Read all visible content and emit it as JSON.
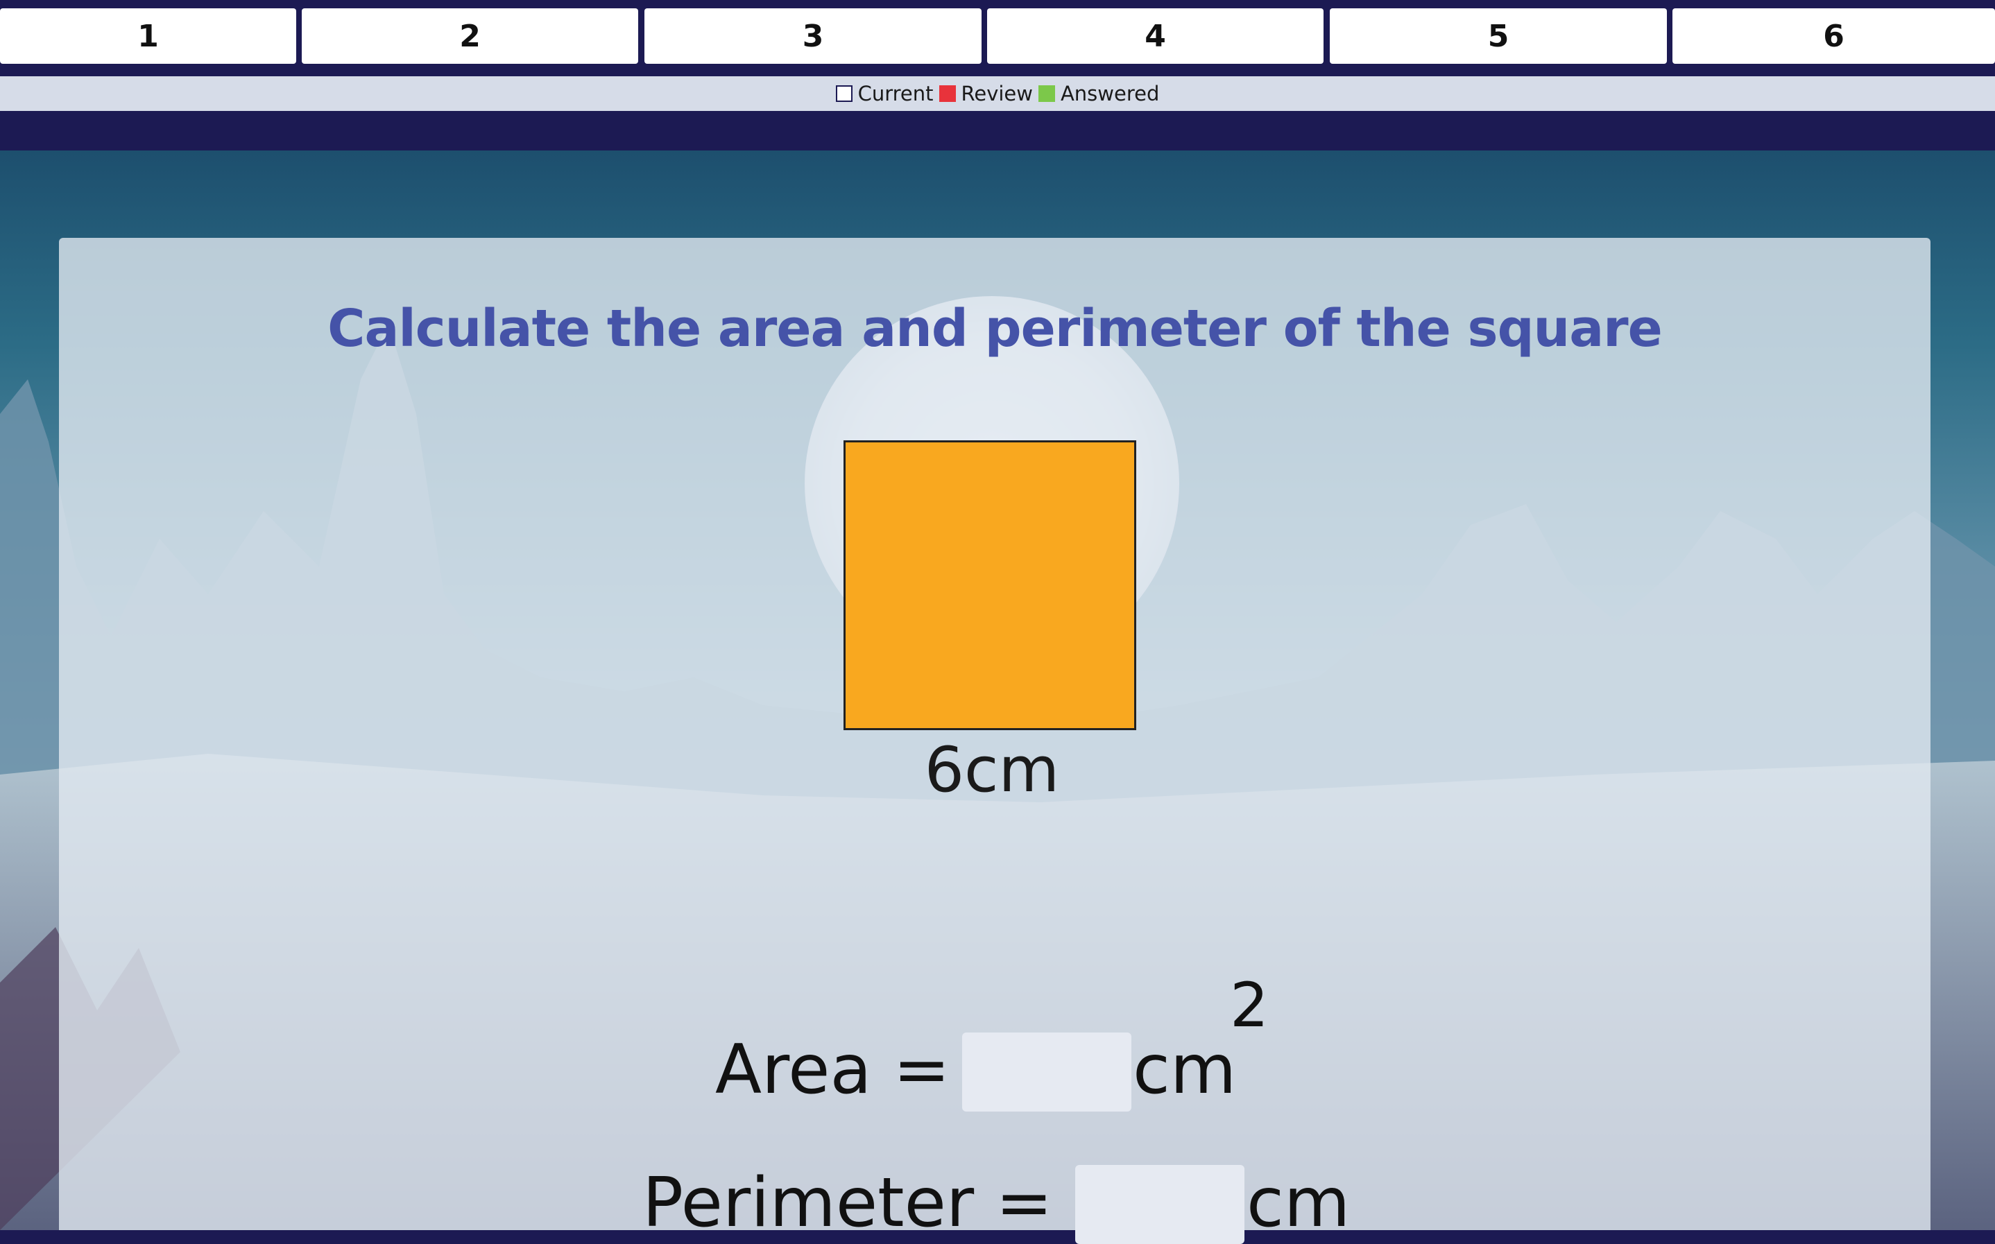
{
  "nav": {
    "questions": [
      "1",
      "2",
      "3",
      "4",
      "5",
      "6"
    ]
  },
  "legend": {
    "current": "Current",
    "review": "Review",
    "answered": "Answered"
  },
  "question": {
    "title": "Calculate the area and perimeter of the square",
    "side_label": "6cm",
    "area_label": "Area =",
    "area_unit": "cm",
    "area_superscript": "2",
    "perimeter_label": "Perimeter =",
    "perimeter_unit": "cm",
    "area_value": "",
    "perimeter_value": ""
  },
  "colors": {
    "nav_bg": "#1c1a53",
    "square_fill": "#f9a81f",
    "title": "#4553a8",
    "review": "#e8333b",
    "answered": "#7cc84a"
  }
}
